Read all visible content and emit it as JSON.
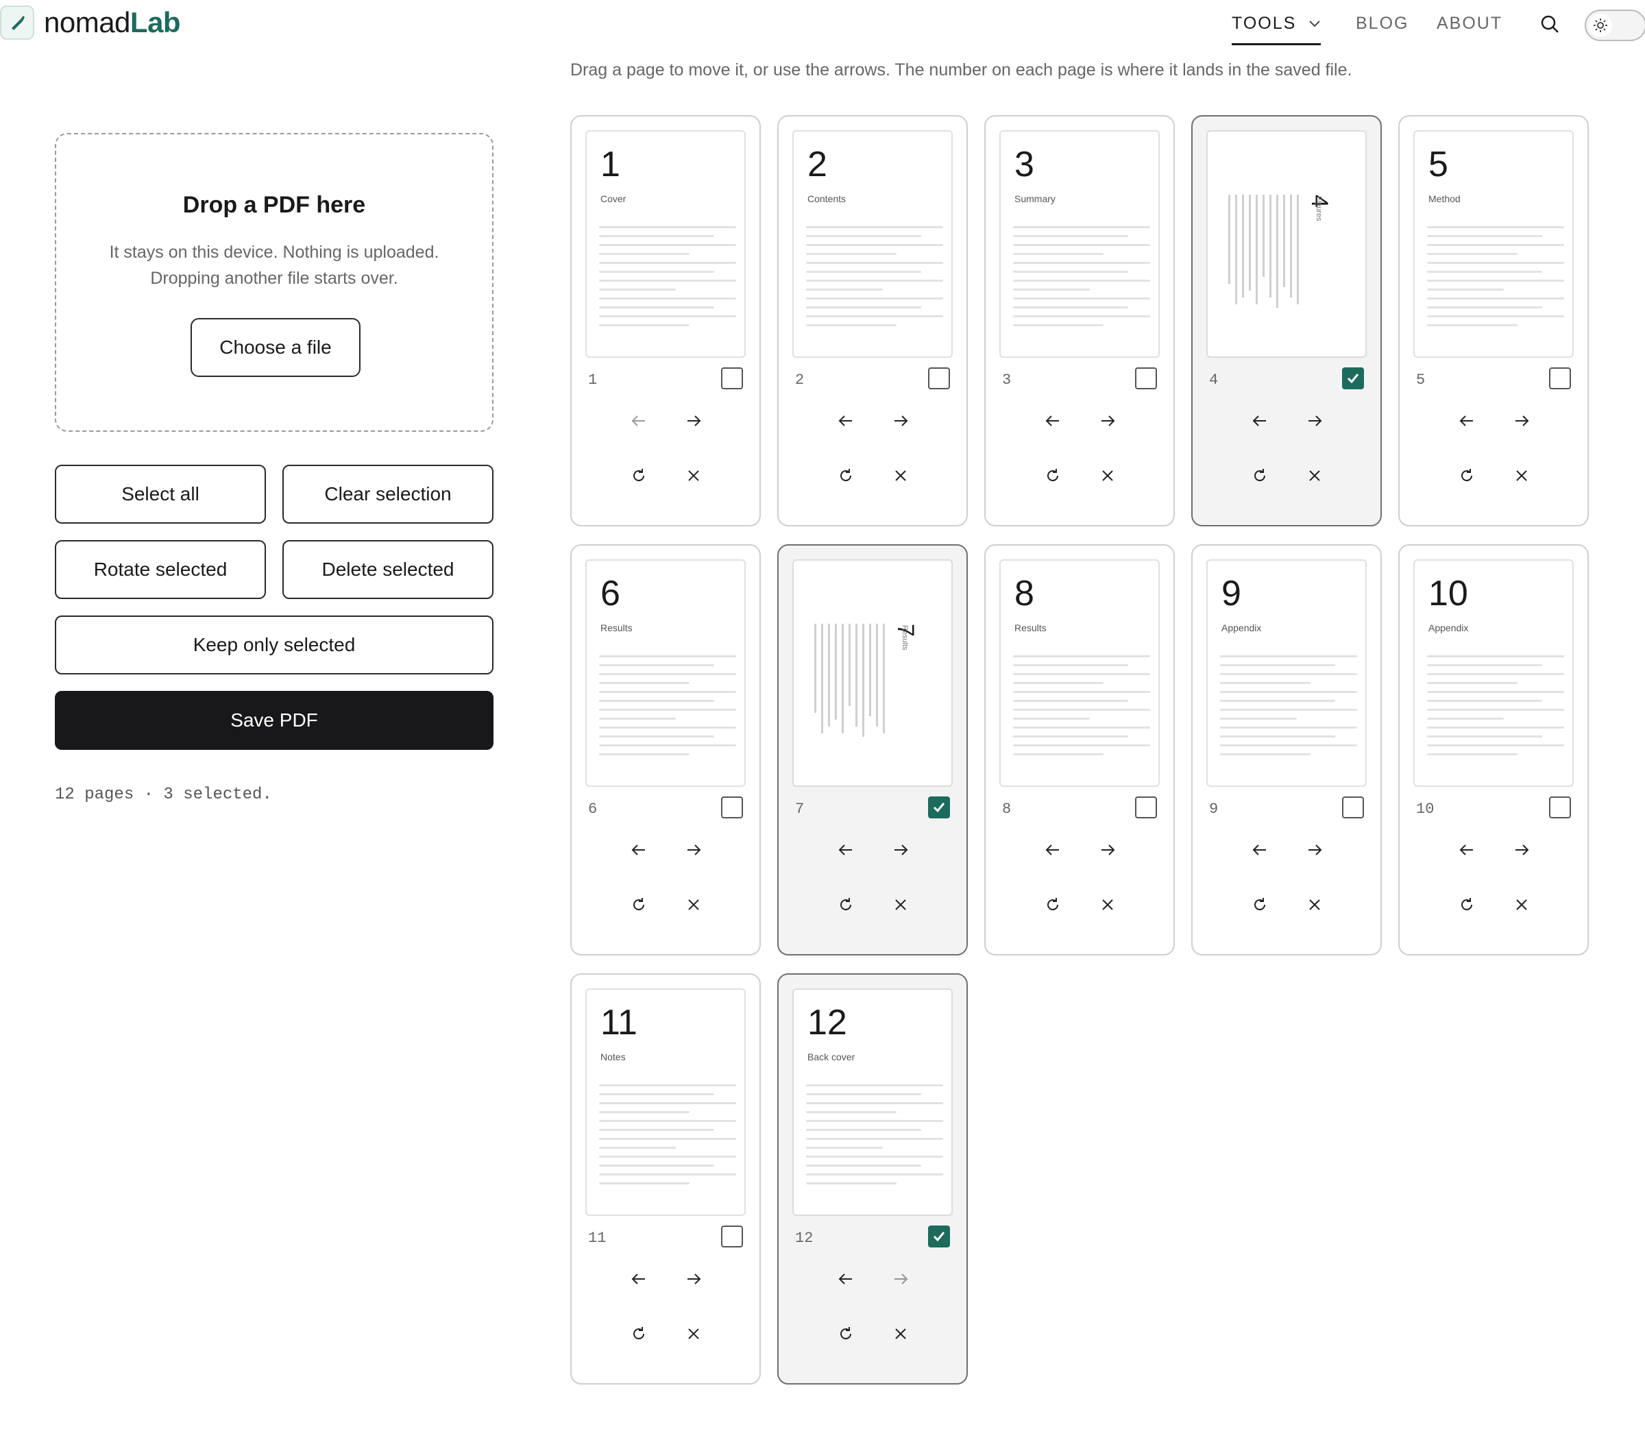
{
  "header": {
    "brand_prefix": "nomad",
    "brand_suffix": "Lab",
    "nav": {
      "tools": "TOOLS",
      "blog": "BLOG",
      "about": "ABOUT"
    }
  },
  "hint": "Drag a page to move it, or use the arrows. The number on each page is where it lands in the saved file.",
  "dropzone": {
    "title": "Drop a PDF here",
    "line1": "It stays on this device. Nothing is uploaded.",
    "line2": "Dropping another file starts over.",
    "choose_label": "Choose a file"
  },
  "actions": {
    "select_all": "Select all",
    "clear_selection": "Clear selection",
    "rotate_selected": "Rotate selected",
    "delete_selected": "Delete selected",
    "keep_only_selected": "Keep only selected",
    "save_pdf": "Save PDF"
  },
  "status": "12 pages · 3 selected.",
  "colors": {
    "accent": "#1c6b5c",
    "dark_button": "#18181b"
  },
  "pages": [
    {
      "num": "1",
      "label": "Cover",
      "pos": "1",
      "selected": false,
      "figure": false
    },
    {
      "num": "2",
      "label": "Contents",
      "pos": "2",
      "selected": false,
      "figure": false
    },
    {
      "num": "3",
      "label": "Summary",
      "pos": "3",
      "selected": false,
      "figure": false
    },
    {
      "num": "4",
      "label": "Figures",
      "pos": "4",
      "selected": true,
      "figure": true
    },
    {
      "num": "5",
      "label": "Method",
      "pos": "5",
      "selected": false,
      "figure": false
    },
    {
      "num": "6",
      "label": "Results",
      "pos": "6",
      "selected": false,
      "figure": false
    },
    {
      "num": "7",
      "label": "Results",
      "pos": "7",
      "selected": true,
      "figure": true
    },
    {
      "num": "8",
      "label": "Results",
      "pos": "8",
      "selected": false,
      "figure": false
    },
    {
      "num": "9",
      "label": "Appendix",
      "pos": "9",
      "selected": false,
      "figure": false
    },
    {
      "num": "10",
      "label": "Appendix",
      "pos": "10",
      "selected": false,
      "figure": false
    },
    {
      "num": "11",
      "label": "Notes",
      "pos": "11",
      "selected": false,
      "figure": false
    },
    {
      "num": "12",
      "label": "Back cover",
      "pos": "12",
      "selected": true,
      "figure": false
    }
  ]
}
